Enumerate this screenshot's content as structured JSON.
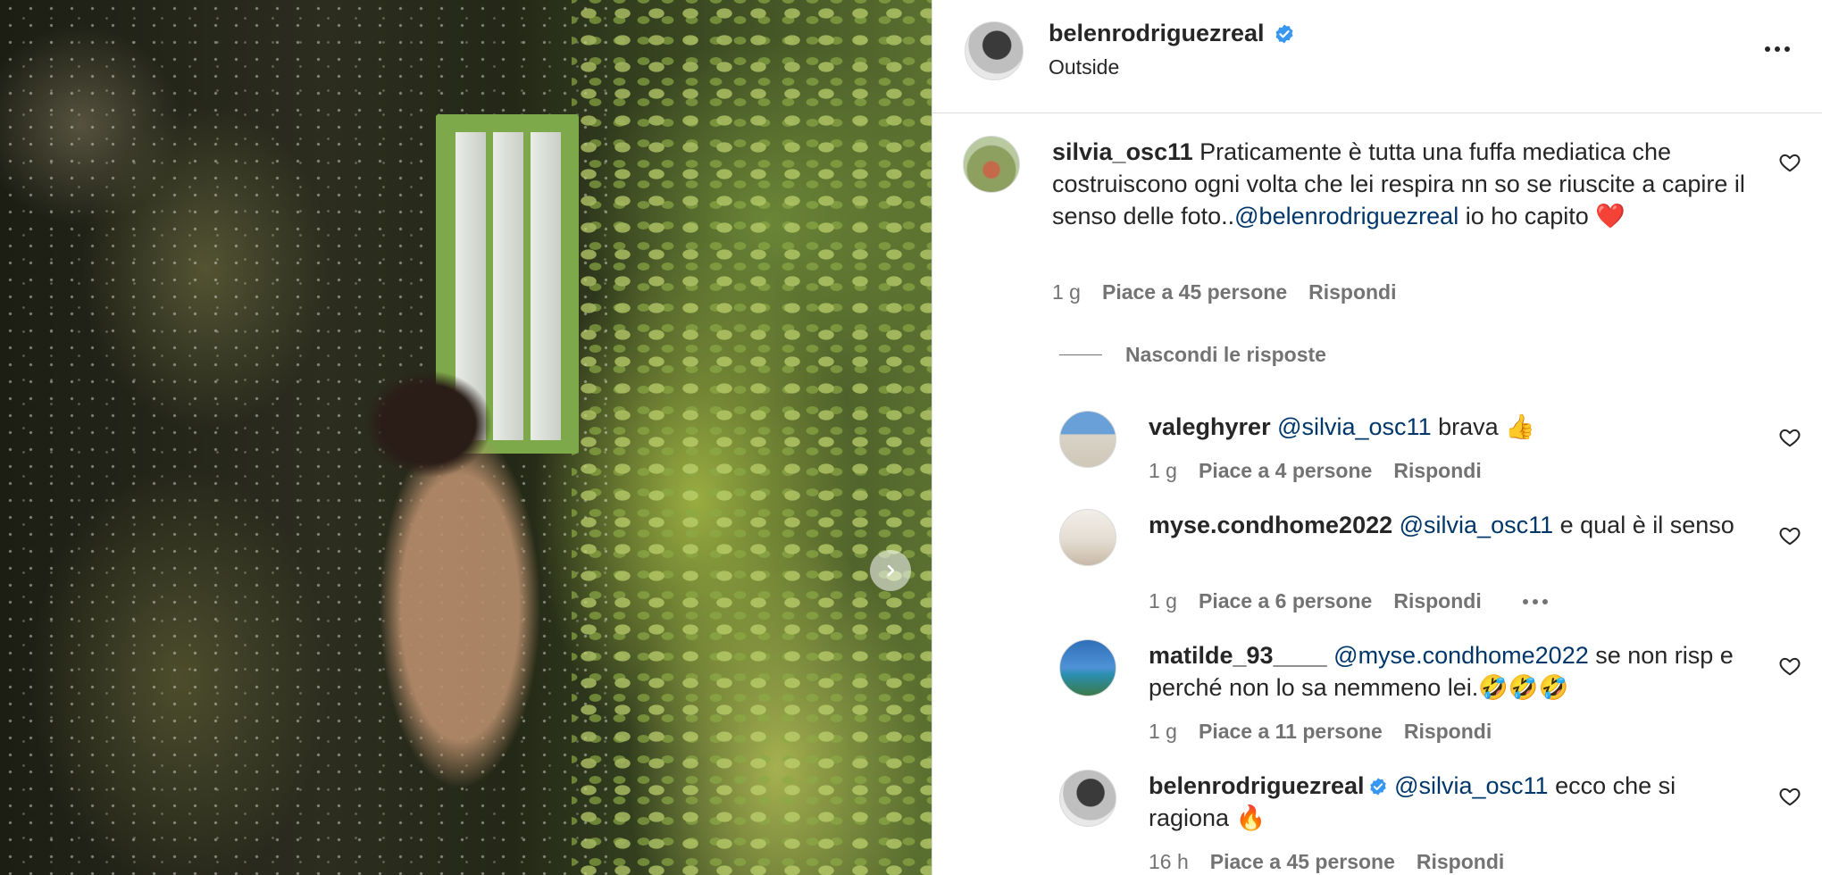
{
  "post": {
    "username": "belenrodriguezreal",
    "location": "Outside",
    "verified": true
  },
  "icons": {
    "verified": "verified-badge-icon",
    "more": "more-options-icon",
    "heart": "heart-outline-icon",
    "next": "chevron-right-icon"
  },
  "colors": {
    "verified": "#3897f0",
    "mention": "#00376b",
    "meta": "#737373"
  },
  "comments": [
    {
      "user": "silvia_osc11",
      "parts": [
        "Praticamente è tutta una fuffa mediatica che costruiscono ogni volta che lei respira nn so se riuscite a capire il senso delle foto..",
        "@belenrodriguezreal",
        " io ho capito ❤️"
      ],
      "time": "1 g",
      "likes": "Piace a 45 persone",
      "reply": "Rispondi"
    }
  ],
  "replies_toggle": "Nascondi le risposte",
  "replies": [
    {
      "user": "valeghyrer",
      "mention": "@silvia_osc11",
      "text": " brava 👍",
      "time": "1 g",
      "likes": "Piace a 4 persone",
      "reply": "Rispondi"
    },
    {
      "user": "myse.condhome2022",
      "mention": "@silvia_osc11",
      "text": " e qual è il senso",
      "time": "1 g",
      "likes": "Piace a 6 persone",
      "reply": "Rispondi"
    },
    {
      "user": "matilde_93____",
      "mention": "@myse.condhome2022",
      "text": " se non risp e perché non lo sa nemmeno lei.🤣🤣🤣",
      "time": "1 g",
      "likes": "Piace a 11 persone",
      "reply": "Rispondi"
    },
    {
      "user": "belenrodriguezreal",
      "mention": "@silvia_osc11",
      "text": " ecco che si ragiona 🔥",
      "time": "16 h",
      "likes": "Piace a 45 persone",
      "reply": "Rispondi"
    }
  ]
}
